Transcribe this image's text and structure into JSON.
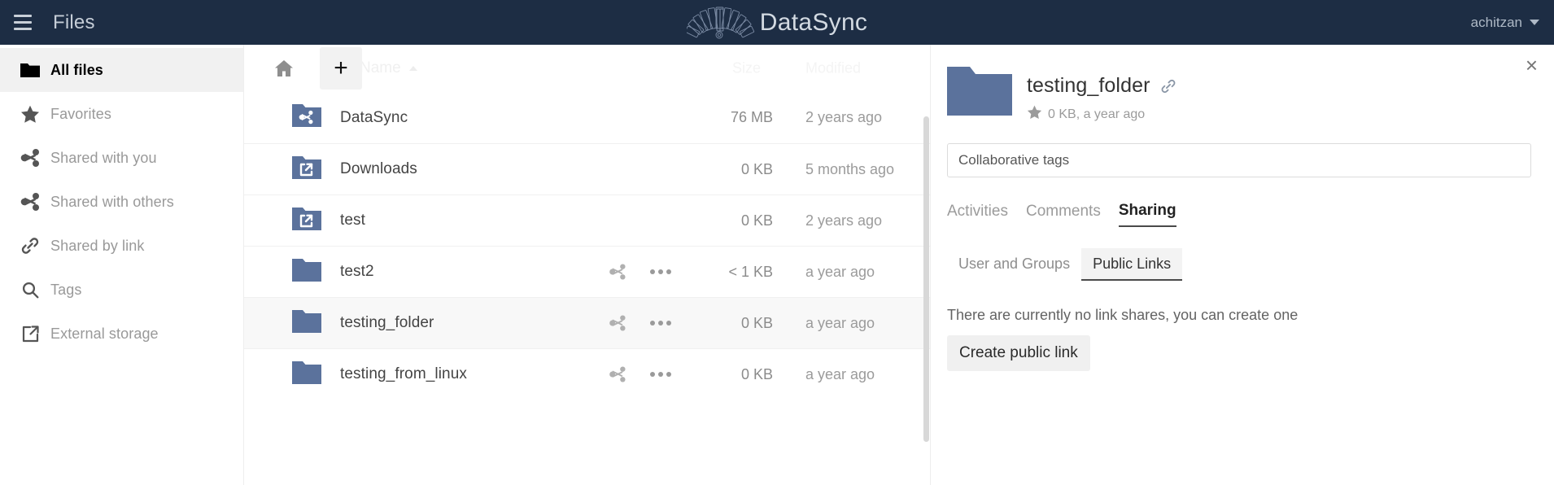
{
  "header": {
    "menu_icon": "hamburger-icon",
    "app_name": "Files",
    "logo_icon": "datasync-fan-logo",
    "logo_text": "DataSync",
    "user_name": "achitzan",
    "caret_icon": "chevron-down-icon",
    "bg_color": "#1d2d44"
  },
  "sidebar": {
    "items": [
      {
        "label": "All files",
        "icon": "folder-icon",
        "active": true
      },
      {
        "label": "Favorites",
        "icon": "star-icon",
        "active": false
      },
      {
        "label": "Shared with you",
        "icon": "share-icon",
        "active": false
      },
      {
        "label": "Shared with others",
        "icon": "share-icon",
        "active": false
      },
      {
        "label": "Shared by link",
        "icon": "link-icon",
        "active": false
      },
      {
        "label": "Tags",
        "icon": "search-icon",
        "active": false
      },
      {
        "label": "External storage",
        "icon": "external-link-icon",
        "active": false
      }
    ]
  },
  "filelist": {
    "home_icon": "home-icon",
    "new_button_icon": "plus-icon",
    "columns": {
      "name": "Name",
      "name_sort": "ascending",
      "size": "Size",
      "modified": "Modified"
    },
    "rows": [
      {
        "name": "DataSync",
        "icon": "folder-shared-icon",
        "size": "76 MB",
        "modified": "2 years ago",
        "selected": false,
        "actions": false
      },
      {
        "name": "Downloads",
        "icon": "folder-external-icon",
        "size": "0 KB",
        "modified": "5 months ago",
        "selected": false,
        "actions": false
      },
      {
        "name": "test",
        "icon": "folder-external-icon",
        "size": "0 KB",
        "modified": "2 years ago",
        "selected": false,
        "actions": false
      },
      {
        "name": "test2",
        "icon": "folder-icon",
        "size": "< 1 KB",
        "modified": "a year ago",
        "selected": false,
        "actions": true
      },
      {
        "name": "testing_folder",
        "icon": "folder-icon",
        "size": "0 KB",
        "modified": "a year ago",
        "selected": true,
        "actions": true
      },
      {
        "name": "testing_from_linux",
        "icon": "folder-icon",
        "size": "0 KB",
        "modified": "a year ago",
        "selected": false,
        "actions": true
      }
    ]
  },
  "details": {
    "close_icon": "close-icon",
    "thumb_icon": "folder-icon",
    "title": "testing_folder",
    "link_icon": "link-icon",
    "favorite_icon": "star-icon",
    "subtitle": "0 KB, a year ago",
    "tags_placeholder": "Collaborative tags",
    "tags_value": "",
    "tabs": [
      {
        "label": "Activities",
        "active": false
      },
      {
        "label": "Comments",
        "active": false
      },
      {
        "label": "Sharing",
        "active": true
      }
    ],
    "share_tabs": [
      {
        "label": "User and Groups",
        "active": false
      },
      {
        "label": "Public Links",
        "active": true
      }
    ],
    "no_shares_message": "There are currently no link shares, you can create one",
    "create_link_label": "Create public link"
  },
  "colors": {
    "header_bg": "#1d2d44",
    "folder_blue": "#5b729c",
    "accent_text": "#c5cdd7"
  }
}
